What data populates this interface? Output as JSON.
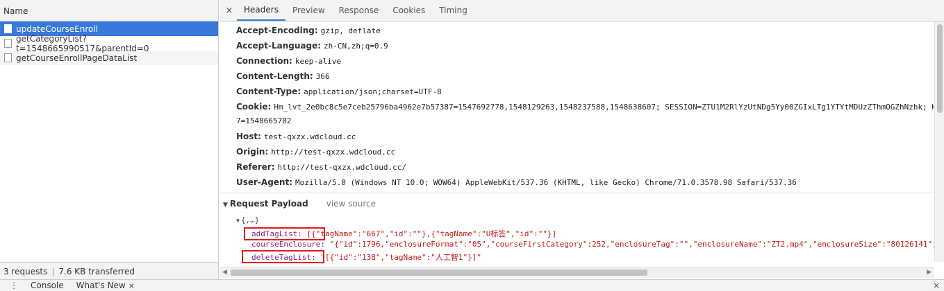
{
  "left": {
    "column_header": "Name",
    "requests": [
      {
        "name": "updateCourseEnroll"
      },
      {
        "name": "getCategoryList?t=1548665990517&parentId=0"
      },
      {
        "name": "getCourseEnrollPageDataList"
      }
    ],
    "footer": {
      "count": "3 requests",
      "separator": "|",
      "transferred": "7.6 KB transferred"
    }
  },
  "tabs": {
    "close": "×",
    "items": [
      "Headers",
      "Preview",
      "Response",
      "Cookies",
      "Timing"
    ],
    "active": "Headers"
  },
  "headers": [
    {
      "key": "Accept-Encoding:",
      "value": "gzip, deflate"
    },
    {
      "key": "Accept-Language:",
      "value": "zh-CN,zh;q=0.9"
    },
    {
      "key": "Connection:",
      "value": "keep-alive"
    },
    {
      "key": "Content-Length:",
      "value": "366"
    },
    {
      "key": "Content-Type:",
      "value": "application/json;charset=UTF-8"
    },
    {
      "key": "Cookie:",
      "value": "Hm_lvt_2e0bc8c5e7ceb25796ba4962e7b57387=1547692778,1548129263,1548237588,1548638607; SESSION=ZTU1M2RlYzUtNDg5Yy00ZGIxLTg1YTYtMDUzZThmOGZhNzhk; Hm_"
    },
    {
      "key": "",
      "value": "7=1548665782"
    },
    {
      "key": "Host:",
      "value": "test-qxzx.wdcloud.cc"
    },
    {
      "key": "Origin:",
      "value": "http://test-qxzx.wdcloud.cc"
    },
    {
      "key": "Referer:",
      "value": "http://test-qxzx.wdcloud.cc/"
    },
    {
      "key": "User-Agent:",
      "value": "Mozilla/5.0 (Windows NT 10.0; WOW64) AppleWebKit/537.36 (KHTML, like Gecko) Chrome/71.0.3578.98 Safari/537.36"
    }
  ],
  "payload": {
    "toggle": "▼",
    "title": "Request Payload",
    "view_source": "view source",
    "root_toggle": "▼",
    "root": "{,…}",
    "rows": [
      {
        "key": "addTagList:",
        "value": "[{\"tagName\":\"667\",\"id\":\"\"},{\"tagName\":\"U标签\",\"id\":\"\"}]"
      },
      {
        "key": "courseEnclosure:",
        "value": "\"{\"id\":1796,\"enclosureFormat\":\"05\",\"courseFirstCategory\":252,\"enclosureTag\":\"\",\"enclosureName\":\"ZT2.mp4\",\"enclosureSize\":\"80126141\",\""
      },
      {
        "key": "deleteTagList:",
        "value": "\"[{\"id\":\"138\",\"tagName\":\"人工智1\"}]\""
      }
    ]
  },
  "scroll": {
    "left_arrow": "◀",
    "right_arrow": "▶"
  },
  "drawer": {
    "menu": "⋮",
    "tabs": [
      {
        "label": "Console"
      },
      {
        "label": "What's New",
        "close": "×"
      }
    ],
    "close": "×"
  },
  "colors": {
    "selected_row": "#3879d9",
    "highlight_box": "#e21b1b",
    "payload_key": "#8a1a8a",
    "payload_value": "#c41a16"
  }
}
